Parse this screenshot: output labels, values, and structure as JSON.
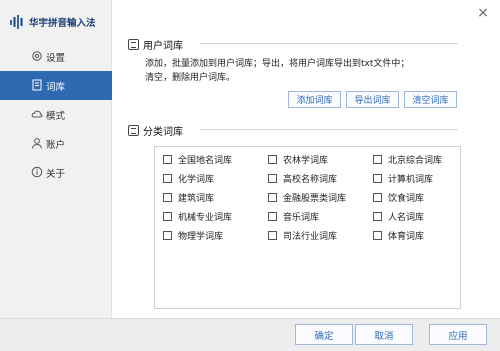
{
  "brand": {
    "title": "华宇拼音输入法"
  },
  "nav": [
    {
      "label": "设置",
      "icon": "gear-icon",
      "active": false
    },
    {
      "label": "词库",
      "icon": "book-icon",
      "active": true
    },
    {
      "label": "模式",
      "icon": "cloud-icon",
      "active": false
    },
    {
      "label": "账户",
      "icon": "user-icon",
      "active": false
    },
    {
      "label": "关于",
      "icon": "info-icon",
      "active": false
    }
  ],
  "user_dict": {
    "title": "用户词库",
    "desc_line1": "添加，批量添加到用户词库；导出，将用户词库导出到txt文件中；",
    "desc_line2": "清空，删除用户词库。",
    "btn_add": "添加词库",
    "btn_export": "导出词库",
    "btn_clear": "清空词库"
  },
  "category_dict": {
    "title": "分类词库",
    "items": [
      {
        "label": "全国地名词库",
        "checked": false
      },
      {
        "label": "农林学词库",
        "checked": false
      },
      {
        "label": "北京综合词库",
        "checked": false
      },
      {
        "label": "化学词库",
        "checked": false
      },
      {
        "label": "高校名称词库",
        "checked": false
      },
      {
        "label": "计算机词库",
        "checked": false
      },
      {
        "label": "建筑词库",
        "checked": false
      },
      {
        "label": "金融股票类词库",
        "checked": false
      },
      {
        "label": "饮食词库",
        "checked": false
      },
      {
        "label": "机械专业词库",
        "checked": false
      },
      {
        "label": "音乐词库",
        "checked": false
      },
      {
        "label": "人名词库",
        "checked": false
      },
      {
        "label": "物理学词库",
        "checked": false
      },
      {
        "label": "司法行业词库",
        "checked": false
      },
      {
        "label": "体育词库",
        "checked": false
      }
    ]
  },
  "footer": {
    "ok": "确定",
    "cancel": "取消",
    "apply": "应用"
  },
  "window": {
    "close_glyph": "×"
  },
  "colors": {
    "accent": "#2e6ab1",
    "brand": "#1d3f7a"
  }
}
